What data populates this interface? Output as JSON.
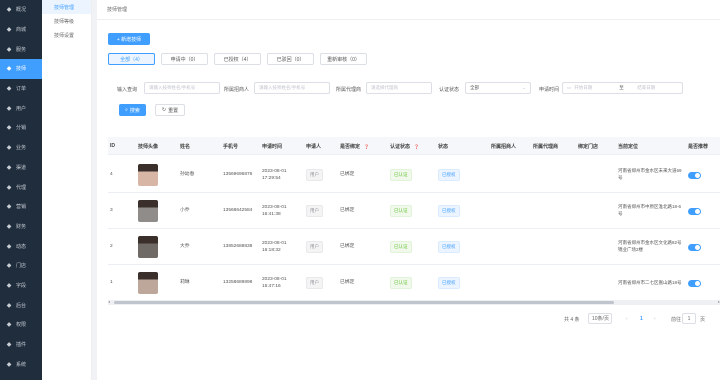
{
  "sidebar": {
    "items": [
      {
        "label": "概况",
        "icon": "home-icon"
      },
      {
        "label": "商城",
        "icon": "shop-icon"
      },
      {
        "label": "服务",
        "icon": "service-icon"
      },
      {
        "label": "技师",
        "icon": "technician-icon",
        "active": true
      },
      {
        "label": "订单",
        "icon": "order-icon"
      },
      {
        "label": "用户",
        "icon": "user-icon"
      },
      {
        "label": "分销",
        "icon": "share-icon"
      },
      {
        "label": "业务",
        "icon": "business-icon"
      },
      {
        "label": "渠道",
        "icon": "channel-icon"
      },
      {
        "label": "代理",
        "icon": "agent-icon"
      },
      {
        "label": "营销",
        "icon": "marketing-icon"
      },
      {
        "label": "财务",
        "icon": "finance-icon"
      },
      {
        "label": "动态",
        "icon": "feed-icon"
      },
      {
        "label": "门店",
        "icon": "store-icon"
      },
      {
        "label": "字段",
        "icon": "field-icon"
      },
      {
        "label": "后台",
        "icon": "backend-icon"
      },
      {
        "label": "权限",
        "icon": "permission-icon"
      },
      {
        "label": "插件",
        "icon": "plugin-icon"
      },
      {
        "label": "系统",
        "icon": "system-icon"
      }
    ]
  },
  "submenu": {
    "items": [
      {
        "label": "技师管理",
        "active": true
      },
      {
        "label": "技师等级"
      },
      {
        "label": "技师设置"
      }
    ]
  },
  "breadcrumb": "技师管理",
  "toolbar": {
    "add_label": "+ 新增技师"
  },
  "tabs": [
    {
      "label": "全部（4）",
      "active": true
    },
    {
      "label": "申请中（0）"
    },
    {
      "label": "已授权（4）"
    },
    {
      "label": "已驳回（0）"
    },
    {
      "label": "重新审核（0）"
    }
  ],
  "filters": {
    "keyword_label": "输入查询",
    "keyword_placeholder": "请输入技师姓名/手机号",
    "referrer_label": "所属招商人",
    "referrer_placeholder": "请输入技师姓名/手机号",
    "agent_label": "所属代理商",
    "agent_placeholder": "请选择代理商",
    "cert_label": "认证状态",
    "cert_value": "全部",
    "date_label": "申请时间",
    "date_start": "开始日期",
    "date_to": "至",
    "date_end": "结束日期",
    "search_label": "搜索",
    "reset_label": "重置"
  },
  "table": {
    "headers": [
      "ID",
      "技师头像",
      "姓名",
      "手机号",
      "申请时间",
      "申请人",
      "是否绑定",
      "认证状态",
      "状态",
      "所属招商人",
      "所属代理商",
      "绑定门店",
      "当前定位",
      "是否推荐"
    ],
    "rows": [
      {
        "id": "4",
        "name": "孙幼春",
        "phone": "13569696876",
        "time_date": "2023-08-01",
        "time_clock": "17:29:54",
        "applicant": "用户",
        "bound": "已绑定",
        "cert": "已认证",
        "status": "已授权",
        "location": "河南省郑州市金水区未来大道69号",
        "avatar_color": "#d8b6a6"
      },
      {
        "id": "3",
        "name": "小乔",
        "phone": "13568642584",
        "time_date": "2023-08-01",
        "time_clock": "16:41:38",
        "applicant": "用户",
        "bound": "已绑定",
        "cert": "已认证",
        "status": "已授权",
        "location": "河南省郑州市中原区淮北路18-6号",
        "avatar_color": "#8f8c8a"
      },
      {
        "id": "2",
        "name": "大乔",
        "phone": "13852688838",
        "time_date": "2023-08-01",
        "time_clock": "16:18:32",
        "applicant": "用户",
        "bound": "已绑定",
        "cert": "已认证",
        "status": "已授权",
        "location": "河南省郑州市金水区文化路82号锦业广场2楼",
        "avatar_color": "#6f6a66"
      },
      {
        "id": "1",
        "name": "莉琳",
        "phone": "13258689898",
        "time_date": "2023-08-01",
        "time_clock": "15:47:16",
        "applicant": "用户",
        "bound": "已绑定",
        "cert": "已认证",
        "status": "已授权",
        "location": "河南省郑州市二七区嵩山路18号",
        "avatar_color": "#bca79a"
      }
    ]
  },
  "pagination": {
    "total": "共 4 条",
    "page_size": "10条/页",
    "current": "1",
    "jump_label": "前往",
    "jump_value": "1",
    "page_unit": "页"
  },
  "colors": {
    "primary": "#409eff",
    "sidebar_bg": "#1f2d3d"
  }
}
